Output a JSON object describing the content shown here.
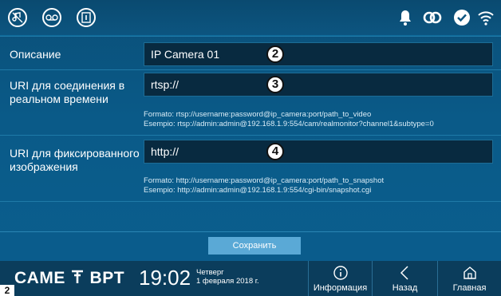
{
  "topbar": {
    "left_icons": [
      "music-off-icon",
      "voicemail-icon",
      "info-door-icon"
    ],
    "right_icons": [
      "bell-icon",
      "link-icon",
      "check-icon",
      "wifi-icon"
    ]
  },
  "form": {
    "description": {
      "label": "Описание",
      "value": "IP Camera 01",
      "marker": "2"
    },
    "realtime_uri": {
      "label_line1": "URI для соединения в",
      "label_line2": "реальном времени",
      "value": "rtsp://",
      "marker": "3",
      "hint_format": "Formato: rtsp://username:password@ip_camera:port/path_to_video",
      "hint_example": "Esempio: rtsp://admin:admin@192.168.1.9:554/cam/realmonitor?channel1&subtype=0"
    },
    "snapshot_uri": {
      "label_line1": "URI для фиксированного",
      "label_line2": "изображения",
      "value": "http://",
      "marker": "4",
      "hint_format": "Formato: http://username:password@ip_camera:port/path_to_snapshot",
      "hint_example": "Esempio: http://admin:admin@192.168.1.9:554/cgi-bin/snapshot.cgi"
    },
    "save_label": "Сохранить"
  },
  "footer": {
    "brand_left": "CAME",
    "brand_right": "BPT",
    "time": "19:02",
    "day": "Четверг",
    "date": "1 февраля 2018 г.",
    "nav": [
      {
        "label": "Информация",
        "icon": "info-icon"
      },
      {
        "label": "Назад",
        "icon": "back-chevron-icon"
      },
      {
        "label": "Главная",
        "icon": "home-icon"
      }
    ],
    "page_badge": "2"
  }
}
